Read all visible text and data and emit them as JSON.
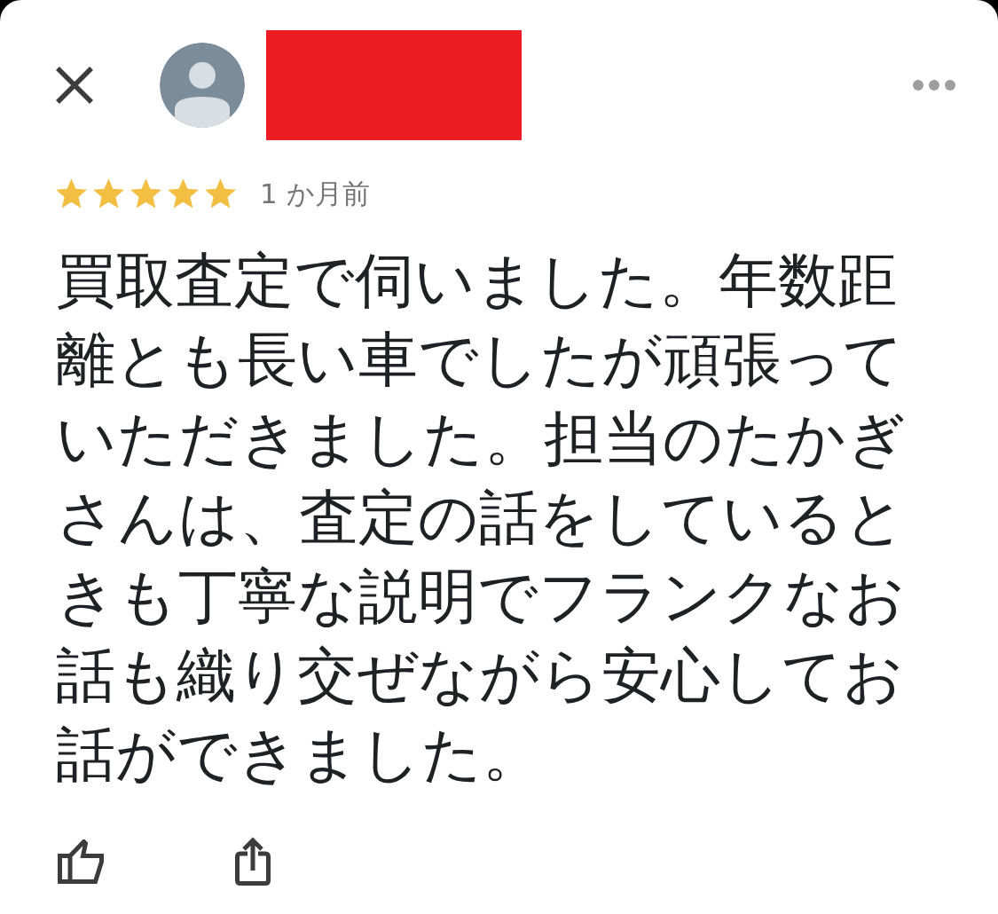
{
  "review": {
    "stars": 5,
    "time": "1 か月前",
    "text": "買取査定で伺いました。年数距離とも長い車でしたが頑張っていただきました。担当のたかぎさんは、査定の話をしているときも丁寧な説明でフランクなお話も織り交ぜながら安心してお話ができました。"
  }
}
